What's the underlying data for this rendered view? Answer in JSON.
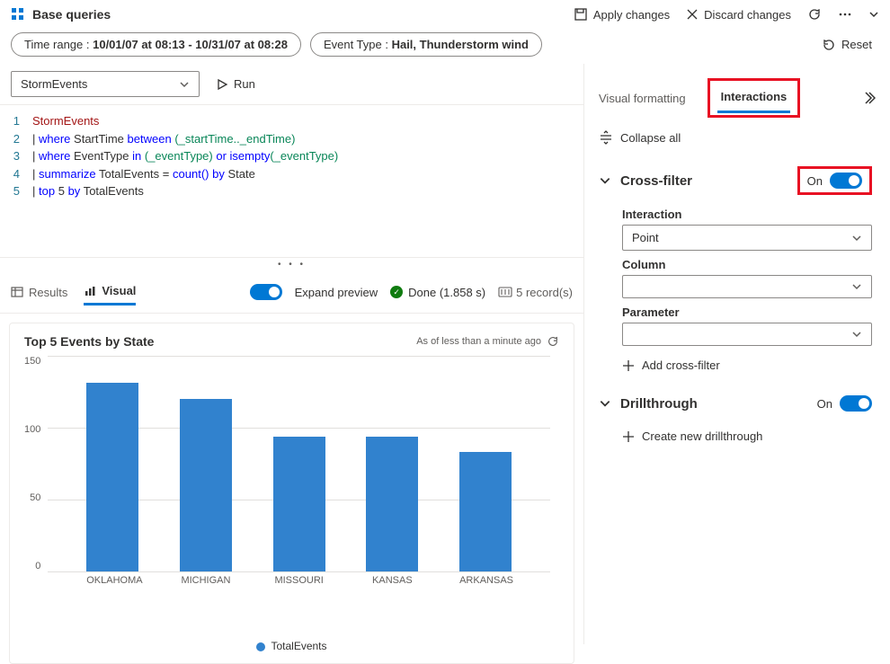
{
  "header": {
    "title": "Base queries",
    "apply": "Apply changes",
    "discard": "Discard changes"
  },
  "pills": {
    "time_label": "Time range : ",
    "time_value": "10/01/07 at 08:13 - 10/31/07 at 08:28",
    "event_label": "Event Type : ",
    "event_value": "Hail, Thunderstorm wind",
    "reset": "Reset"
  },
  "toolbar": {
    "dataset": "StormEvents",
    "run": "Run"
  },
  "code": {
    "l1": "StormEvents",
    "l2": {
      "kw": "where",
      "f": "StartTime",
      "bw": "between",
      "v": "(_startTime.._endTime)"
    },
    "l3": {
      "kw": "where",
      "f": "EventType",
      "in": "in",
      "v1": "(_eventType)",
      "or": "or",
      "fn": "isempty",
      "v2": "(_eventType)"
    },
    "l4": {
      "kw": "summarize",
      "f": "TotalEvents",
      "eq": "=",
      "fn": "count()",
      "by": "by",
      "col": "State"
    },
    "l5": {
      "kw": "top",
      "n": "5",
      "by": "by",
      "col": "TotalEvents"
    }
  },
  "resbar": {
    "results": "Results",
    "visual": "Visual",
    "expand": "Expand preview",
    "done": "Done (1.858 s)",
    "records": "5 record(s)"
  },
  "chart_data": {
    "type": "bar",
    "title": "Top 5 Events by State",
    "meta": "As of less than a minute ago",
    "categories": [
      "OKLAHOMA",
      "MICHIGAN",
      "MISSOURI",
      "KANSAS",
      "ARKANSAS"
    ],
    "values": [
      131,
      120,
      94,
      94,
      83
    ],
    "ylim": [
      0,
      150
    ],
    "yticks": [
      0,
      50,
      100,
      150
    ],
    "legend": "TotalEvents"
  },
  "panel": {
    "tab1": "Visual formatting",
    "tab2": "Interactions",
    "collapse": "Collapse all",
    "cross_filter": {
      "title": "Cross-filter",
      "state": "On",
      "interaction_label": "Interaction",
      "interaction_value": "Point",
      "column_label": "Column",
      "parameter_label": "Parameter",
      "add": "Add cross-filter"
    },
    "drill": {
      "title": "Drillthrough",
      "state": "On",
      "add": "Create new drillthrough"
    }
  }
}
